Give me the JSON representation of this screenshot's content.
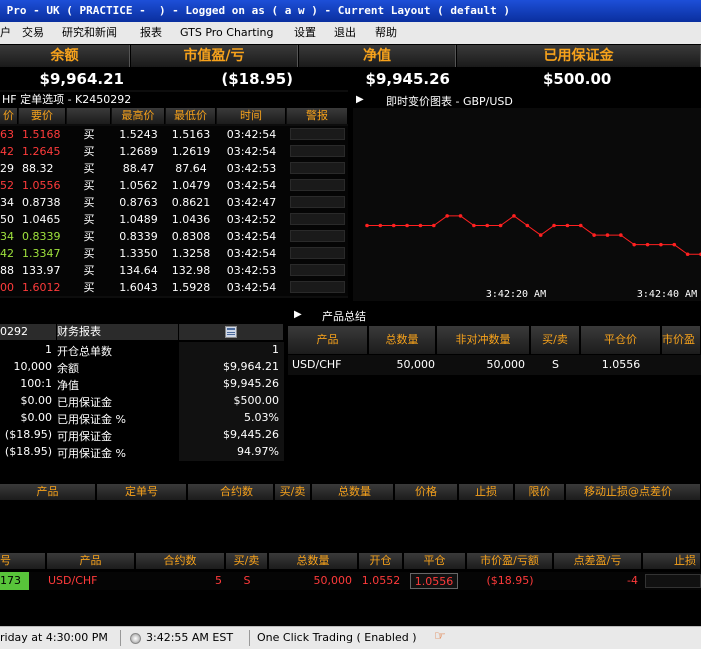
{
  "window": {
    "title": " Pro - UK ( PRACTICE -  ) - Logged on as ( a w ) - Current Layout ( default )"
  },
  "menu": [
    "户",
    "交易",
    "研究和新闻",
    "报表",
    "GTS Pro Charting",
    "设置",
    "退出",
    "帮助"
  ],
  "summary": {
    "headers": [
      "余额",
      "市值盈/亏",
      "净值",
      "已用保证金"
    ],
    "values": [
      "$9,964.21",
      "($18.95)",
      "$9,945.26",
      "$500.00"
    ]
  },
  "rates": {
    "title": "HF 定单选项 - K2450292",
    "headers": [
      "价",
      "要价",
      "",
      "最高价",
      "最低价",
      "时间",
      "警报"
    ],
    "rows": [
      {
        "bid": "63",
        "ask": "1.5168",
        "action": "买",
        "high": "1.5243",
        "low": "1.5163",
        "time": "03:42:54",
        "color": "red"
      },
      {
        "bid": "42",
        "ask": "1.2645",
        "action": "买",
        "high": "1.2689",
        "low": "1.2619",
        "time": "03:42:54",
        "color": "red"
      },
      {
        "bid": "29",
        "ask": "88.32",
        "action": "买",
        "high": "88.47",
        "low": "87.64",
        "time": "03:42:53",
        "color": "white"
      },
      {
        "bid": "52",
        "ask": "1.0556",
        "action": "买",
        "high": "1.0562",
        "low": "1.0479",
        "time": "03:42:54",
        "color": "red"
      },
      {
        "bid": "34",
        "ask": "0.8738",
        "action": "买",
        "high": "0.8763",
        "low": "0.8621",
        "time": "03:42:47",
        "color": "white"
      },
      {
        "bid": "50",
        "ask": "1.0465",
        "action": "买",
        "high": "1.0489",
        "low": "1.0436",
        "time": "03:42:52",
        "color": "white"
      },
      {
        "bid": "34",
        "ask": "0.8339",
        "action": "买",
        "high": "0.8339",
        "low": "0.8308",
        "time": "03:42:54",
        "color": "green"
      },
      {
        "bid": "42",
        "ask": "1.3347",
        "action": "买",
        "high": "1.3350",
        "low": "1.3258",
        "time": "03:42:54",
        "color": "green"
      },
      {
        "bid": "88",
        "ask": "133.97",
        "action": "买",
        "high": "134.64",
        "low": "132.98",
        "time": "03:42:53",
        "color": "white"
      },
      {
        "bid": "00",
        "ask": "1.6012",
        "action": "买",
        "high": "1.6043",
        "low": "1.5928",
        "time": "03:42:54",
        "color": "red"
      }
    ]
  },
  "chart": {
    "title": "即时变价图表 - GBP/USD",
    "time_labels": [
      "3:42:20 AM",
      "3:42:40 AM"
    ],
    "line_color": "#ff2020",
    "grid": false
  },
  "chart_data": {
    "type": "line",
    "title": "即时变价图表 - GBP/USD",
    "xlabel": "",
    "ylabel": "",
    "x_tick_labels": [
      "3:42:20 AM",
      "3:42:40 AM"
    ],
    "series": [
      {
        "values": [
          1.5166,
          1.5166,
          1.5166,
          1.5166,
          1.5166,
          1.5166,
          1.5167,
          1.5167,
          1.5166,
          1.5166,
          1.5166,
          1.5167,
          1.5166,
          1.5165,
          1.5166,
          1.5166,
          1.5166,
          1.5165,
          1.5165,
          1.5165,
          1.5164,
          1.5164,
          1.5164,
          1.5164,
          1.5163,
          1.5163
        ]
      }
    ]
  },
  "finance": {
    "account": "0292",
    "title": "财务报表",
    "rows": [
      {
        "left": "1",
        "label": "开仓总单数",
        "value": "1"
      },
      {
        "left": "10,000",
        "label": "余额",
        "value": "$9,964.21"
      },
      {
        "left": "100:1",
        "label": "净值",
        "value": "$9,945.26"
      },
      {
        "left": "$0.00",
        "label": "已用保证金",
        "value": "$500.00"
      },
      {
        "left": "$0.00",
        "label": "已用保证金 %",
        "value": "5.03%"
      },
      {
        "left": "($18.95)",
        "label": "可用保证金",
        "value": "$9,445.26"
      },
      {
        "left": "($18.95)",
        "label": "可用保证金 %",
        "value": "94.97%"
      }
    ]
  },
  "product_summary": {
    "title": "产品总结",
    "headers": [
      "产品",
      "总数量",
      "非对冲数量",
      "买/卖",
      "平仓价",
      "市价盈"
    ],
    "row": {
      "product": "USD/CHF",
      "total": "50,000",
      "unhedged": "50,000",
      "side": "S",
      "close": "1.0556"
    }
  },
  "orders": {
    "headers": [
      "产品",
      "定单号",
      "合约数",
      "买/卖",
      "总数量",
      "价格",
      "止损",
      "限价",
      "移动止损@点差价"
    ]
  },
  "positions": {
    "headers": [
      "号",
      "产品",
      "合约数",
      "买/卖",
      "总数量",
      "开仓",
      "平仓",
      "市价盈/亏额",
      "点差盈/亏",
      "止损"
    ],
    "row": {
      "id": "173",
      "product": "USD/CHF",
      "lots": "5",
      "side": "S",
      "total": "50,000",
      "open": "1.0552",
      "close": "1.0556",
      "pl": "($18.95)",
      "pips": "-4"
    }
  },
  "status": {
    "market": "riday at 4:30:00 PM",
    "clock": "3:42:55 AM EST",
    "one_click": "One Click Trading  ( Enabled )"
  }
}
